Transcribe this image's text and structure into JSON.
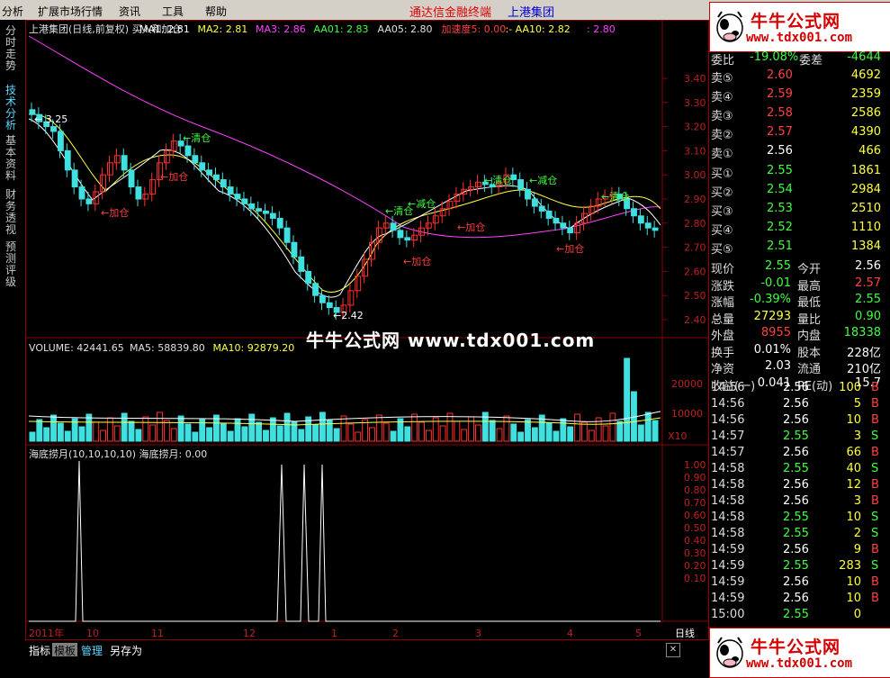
{
  "menu": {
    "items": [
      "分析",
      "扩展市场行情",
      "资讯",
      "工具",
      "帮助"
    ],
    "app_title": "通达信金融终端",
    "stock_title": "上港集团"
  },
  "side_tabs": [
    "分时走势",
    "技术分析",
    "基本资料",
    "财务透视",
    "预测评级"
  ],
  "chart": {
    "header": [
      {
        "text": "上港集团(日线,前复权) 买入和加仓",
        "color": "#e0e0e0"
      },
      {
        "text": "MA1: 2.81",
        "color": "#ffffff"
      },
      {
        "text": "MA2: 2.81",
        "color": "#ffff40"
      },
      {
        "text": "MA3: 2.86",
        "color": "#ff40ff"
      },
      {
        "text": "AA01: 2.83",
        "color": "#40ff40"
      },
      {
        "text": "AA05: 2.80",
        "color": "#e0e0e0"
      },
      {
        "text": "加速度5: 0.00",
        "color": "#ff4040"
      },
      {
        "text": ":- AA10: 2.82",
        "color": "#ffff40"
      },
      {
        "text": ": 2.80",
        "color": "#ff40ff"
      }
    ],
    "price_ticks": [
      "3.40",
      "3.30",
      "3.20",
      "3.10",
      "3.00",
      "2.90",
      "2.80",
      "2.70",
      "2.60",
      "2.50",
      "2.40"
    ],
    "annotations_green": [
      "←清仓",
      "←清仓",
      "←减仓",
      "←清仓",
      "←减仓",
      "←清仓"
    ],
    "annotations_red": [
      "←加仓",
      "←加仓",
      "←加仓",
      "←加仓",
      "←加仓"
    ],
    "high_label": "3.25",
    "low_label": "2.42",
    "volume_header": [
      {
        "text": "VOLUME: 42441.65",
        "color": "#e0e0e0"
      },
      {
        "text": "MA5: 58839.80",
        "color": "#e0e0e0"
      },
      {
        "text": "MA10: 92879.20",
        "color": "#ffff40"
      }
    ],
    "volume_ticks": [
      "20000",
      "10000"
    ],
    "volume_unit": "X10",
    "indicator_header": "海底捞月(10,10,10,10)  海底捞月: 0.00",
    "indicator_ticks": [
      "1.00",
      "0.90",
      "0.80",
      "0.70",
      "0.60",
      "0.50",
      "0.40",
      "0.30",
      "0.20",
      "0.10"
    ],
    "date_labels": [
      "2011年",
      "10",
      "11",
      "12",
      "1",
      "2",
      "3",
      "4",
      "5"
    ],
    "period": "日线",
    "watermark": "牛牛公式网 www.tdx001.com"
  },
  "bottom_tabs": [
    "指标",
    "模板",
    "管理",
    "另存为"
  ],
  "ad": {
    "title": "牛牛公式网",
    "url": "www.tdx001.com"
  },
  "quote": {
    "weibi": {
      "label": "委比",
      "value": "-19.08%",
      "label2": "委差",
      "value2": "-4644"
    },
    "sells": [
      {
        "label": "卖⑤",
        "price": "2.60",
        "vol": "4692"
      },
      {
        "label": "卖④",
        "price": "2.59",
        "vol": "2359"
      },
      {
        "label": "卖③",
        "price": "2.58",
        "vol": "2586"
      },
      {
        "label": "卖②",
        "price": "2.57",
        "vol": "4390"
      },
      {
        "label": "卖①",
        "price": "2.56",
        "vol": "466"
      }
    ],
    "buys": [
      {
        "label": "买①",
        "price": "2.55",
        "vol": "1861"
      },
      {
        "label": "买②",
        "price": "2.54",
        "vol": "2984"
      },
      {
        "label": "买③",
        "price": "2.53",
        "vol": "2510"
      },
      {
        "label": "买④",
        "price": "2.52",
        "vol": "1110"
      },
      {
        "label": "买⑤",
        "price": "2.51",
        "vol": "1384"
      }
    ],
    "stats": [
      {
        "l1": "现价",
        "v1": "2.55",
        "c1": "#40ff40",
        "l2": "今开",
        "v2": "2.56",
        "c2": "#ffffff"
      },
      {
        "l1": "涨跌",
        "v1": "-0.01",
        "c1": "#40ff40",
        "l2": "最高",
        "v2": "2.57",
        "c2": "#ff4040"
      },
      {
        "l1": "涨幅",
        "v1": "-0.39%",
        "c1": "#40ff40",
        "l2": "最低",
        "v2": "2.55",
        "c2": "#40ff40"
      },
      {
        "l1": "总量",
        "v1": "27293",
        "c1": "#ffff40",
        "l2": "量比",
        "v2": "0.90",
        "c2": "#40ff40"
      },
      {
        "l1": "外盘",
        "v1": "8955",
        "c1": "#ff4040",
        "l2": "内盘",
        "v2": "18338",
        "c2": "#40ff40"
      },
      {
        "l1": "换手",
        "v1": "0.01%",
        "c1": "#ffffff",
        "l2": "股本",
        "v2": "228亿",
        "c2": "#ffffff"
      },
      {
        "l1": "净资",
        "v1": "2.03",
        "c1": "#ffffff",
        "l2": "流通",
        "v2": "210亿",
        "c2": "#ffffff"
      },
      {
        "l1": "收益(一)",
        "v1": "0.041",
        "c1": "#ffffff",
        "l2": "PE(动)",
        "v2": "15.7",
        "c2": "#ffffff"
      }
    ],
    "ticks": [
      {
        "t": "14:56",
        "p": "2.56",
        "pc": "#ffffff",
        "v": "100",
        "vc": "#ffff40",
        "d": "B"
      },
      {
        "t": "14:56",
        "p": "2.56",
        "pc": "#ffffff",
        "v": "5",
        "vc": "#ffff40",
        "d": "B"
      },
      {
        "t": "14:56",
        "p": "2.56",
        "pc": "#ffffff",
        "v": "10",
        "vc": "#ffff40",
        "d": "B"
      },
      {
        "t": "14:57",
        "p": "2.55",
        "pc": "#40ff40",
        "v": "3",
        "vc": "#ffff40",
        "d": "S"
      },
      {
        "t": "14:57",
        "p": "2.56",
        "pc": "#ffffff",
        "v": "66",
        "vc": "#ffff40",
        "d": "B"
      },
      {
        "t": "14:58",
        "p": "2.55",
        "pc": "#40ff40",
        "v": "40",
        "vc": "#ffff40",
        "d": "S"
      },
      {
        "t": "14:58",
        "p": "2.56",
        "pc": "#ffffff",
        "v": "12",
        "vc": "#ffff40",
        "d": "B"
      },
      {
        "t": "14:58",
        "p": "2.56",
        "pc": "#ffffff",
        "v": "3",
        "vc": "#ffff40",
        "d": "B"
      },
      {
        "t": "14:58",
        "p": "2.55",
        "pc": "#40ff40",
        "v": "10",
        "vc": "#ffff40",
        "d": "S"
      },
      {
        "t": "14:58",
        "p": "2.55",
        "pc": "#40ff40",
        "v": "2",
        "vc": "#ffff40",
        "d": "S"
      },
      {
        "t": "14:59",
        "p": "2.56",
        "pc": "#ffffff",
        "v": "9",
        "vc": "#ffff40",
        "d": "B"
      },
      {
        "t": "14:59",
        "p": "2.55",
        "pc": "#40ff40",
        "v": "283",
        "vc": "#ffff40",
        "d": "S"
      },
      {
        "t": "14:59",
        "p": "2.56",
        "pc": "#ffffff",
        "v": "10",
        "vc": "#ffff40",
        "d": "B"
      },
      {
        "t": "14:59",
        "p": "2.56",
        "pc": "#ffffff",
        "v": "10",
        "vc": "#ffff40",
        "d": "B"
      },
      {
        "t": "15:00",
        "p": "2.55",
        "pc": "#40ff40",
        "v": "0",
        "vc": "#ffff40",
        "d": ""
      }
    ]
  }
}
